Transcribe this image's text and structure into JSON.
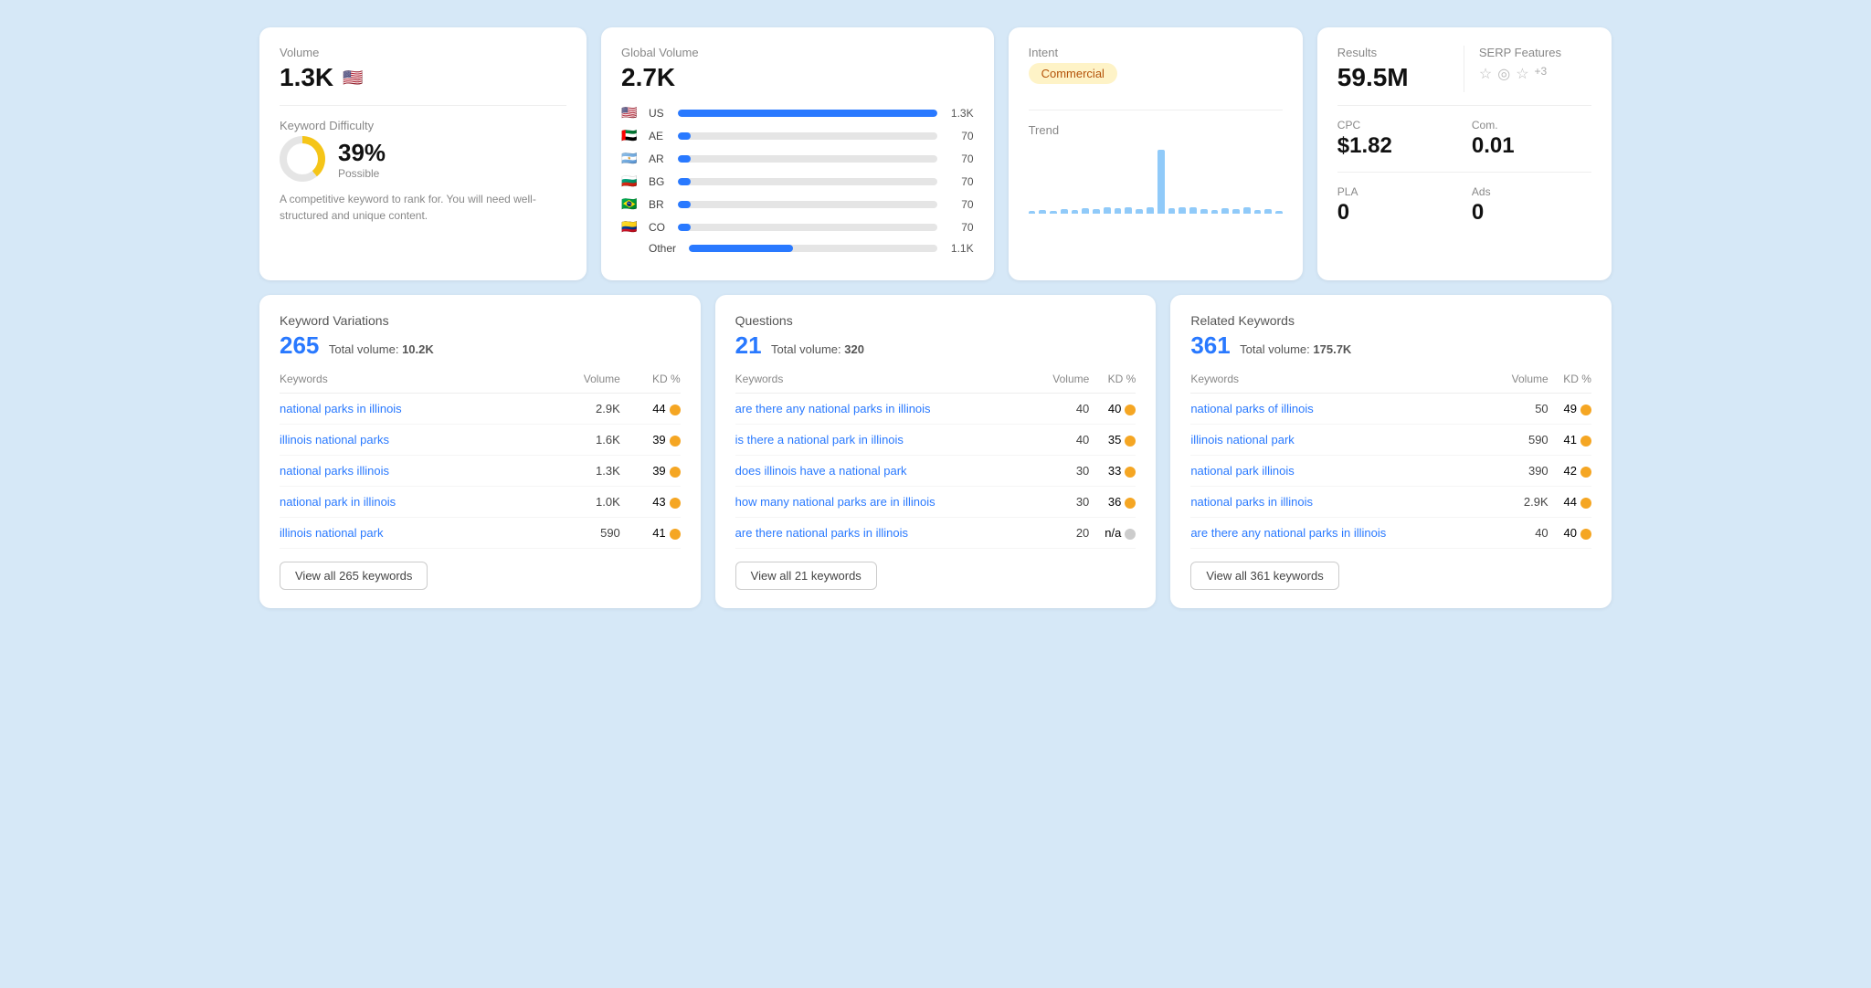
{
  "volume_card": {
    "label": "Volume",
    "value": "1.3K",
    "flag": "🇺🇸",
    "kd_label": "Keyword Difficulty",
    "kd_percent": "39%",
    "kd_possible": "Possible",
    "kd_pct_num": 39,
    "kd_description": "A competitive keyword to rank for. You will need well-structured and unique content."
  },
  "global_volume_card": {
    "label": "Global Volume",
    "value": "2.7K",
    "countries": [
      {
        "flag": "🇺🇸",
        "code": "US",
        "bar_pct": 100,
        "val": "1.3K"
      },
      {
        "flag": "🇦🇪",
        "code": "AE",
        "bar_pct": 5,
        "val": "70"
      },
      {
        "flag": "🇦🇷",
        "code": "AR",
        "bar_pct": 5,
        "val": "70"
      },
      {
        "flag": "🇧🇬",
        "code": "BG",
        "bar_pct": 5,
        "val": "70"
      },
      {
        "flag": "🇧🇷",
        "code": "BR",
        "bar_pct": 5,
        "val": "70"
      },
      {
        "flag": "🇨🇴",
        "code": "CO",
        "bar_pct": 5,
        "val": "70"
      },
      {
        "flag": "",
        "code": "Other",
        "bar_pct": 42,
        "val": "1.1K"
      }
    ]
  },
  "intent_card": {
    "label": "Intent",
    "badge": "Commercial",
    "trend_label": "Trend",
    "trend_bars": [
      2,
      4,
      3,
      5,
      4,
      6,
      5,
      7,
      6,
      8,
      5,
      7,
      75,
      6,
      7,
      8,
      5,
      4,
      6,
      5,
      7,
      4,
      5,
      3
    ]
  },
  "results_card": {
    "results_label": "Results",
    "results_value": "59.5M",
    "serp_label": "SERP Features",
    "serp_plus": "+3",
    "cpc_label": "CPC",
    "cpc_value": "$1.82",
    "com_label": "Com.",
    "com_value": "0.01",
    "pla_label": "PLA",
    "pla_value": "0",
    "ads_label": "Ads",
    "ads_value": "0"
  },
  "keyword_variations": {
    "section_title": "Keyword Variations",
    "count": "265",
    "total_volume_label": "Total volume:",
    "total_volume": "10.2K",
    "col_keywords": "Keywords",
    "col_volume": "Volume",
    "col_kd": "KD %",
    "rows": [
      {
        "keyword": "national parks in illinois",
        "volume": "2.9K",
        "kd": "44",
        "dot": "orange"
      },
      {
        "keyword": "illinois national parks",
        "volume": "1.6K",
        "kd": "39",
        "dot": "orange"
      },
      {
        "keyword": "national parks illinois",
        "volume": "1.3K",
        "kd": "39",
        "dot": "orange"
      },
      {
        "keyword": "national park in illinois",
        "volume": "1.0K",
        "kd": "43",
        "dot": "orange"
      },
      {
        "keyword": "illinois national park",
        "volume": "590",
        "kd": "41",
        "dot": "orange"
      }
    ],
    "view_btn": "View all 265 keywords"
  },
  "questions": {
    "section_title": "Questions",
    "count": "21",
    "total_volume_label": "Total volume:",
    "total_volume": "320",
    "col_keywords": "Keywords",
    "col_volume": "Volume",
    "col_kd": "KD %",
    "rows": [
      {
        "keyword": "are there any national parks in illinois",
        "volume": "40",
        "kd": "40",
        "dot": "orange"
      },
      {
        "keyword": "is there a national park in illinois",
        "volume": "40",
        "kd": "35",
        "dot": "orange"
      },
      {
        "keyword": "does illinois have a national park",
        "volume": "30",
        "kd": "33",
        "dot": "orange"
      },
      {
        "keyword": "how many national parks are in illinois",
        "volume": "30",
        "kd": "36",
        "dot": "orange"
      },
      {
        "keyword": "are there national parks in illinois",
        "volume": "20",
        "kd": "n/a",
        "dot": "gray"
      }
    ],
    "view_btn": "View all 21 keywords"
  },
  "related_keywords": {
    "section_title": "Related Keywords",
    "count": "361",
    "total_volume_label": "Total volume:",
    "total_volume": "175.7K",
    "col_keywords": "Keywords",
    "col_volume": "Volume",
    "col_kd": "KD %",
    "rows": [
      {
        "keyword": "national parks of illinois",
        "volume": "50",
        "kd": "49",
        "dot": "orange"
      },
      {
        "keyword": "illinois national park",
        "volume": "590",
        "kd": "41",
        "dot": "orange"
      },
      {
        "keyword": "national park illinois",
        "volume": "390",
        "kd": "42",
        "dot": "orange"
      },
      {
        "keyword": "national parks in illinois",
        "volume": "2.9K",
        "kd": "44",
        "dot": "orange"
      },
      {
        "keyword": "are there any national parks in illinois",
        "volume": "40",
        "kd": "40",
        "dot": "orange"
      }
    ],
    "view_btn": "View all 361 keywords"
  }
}
